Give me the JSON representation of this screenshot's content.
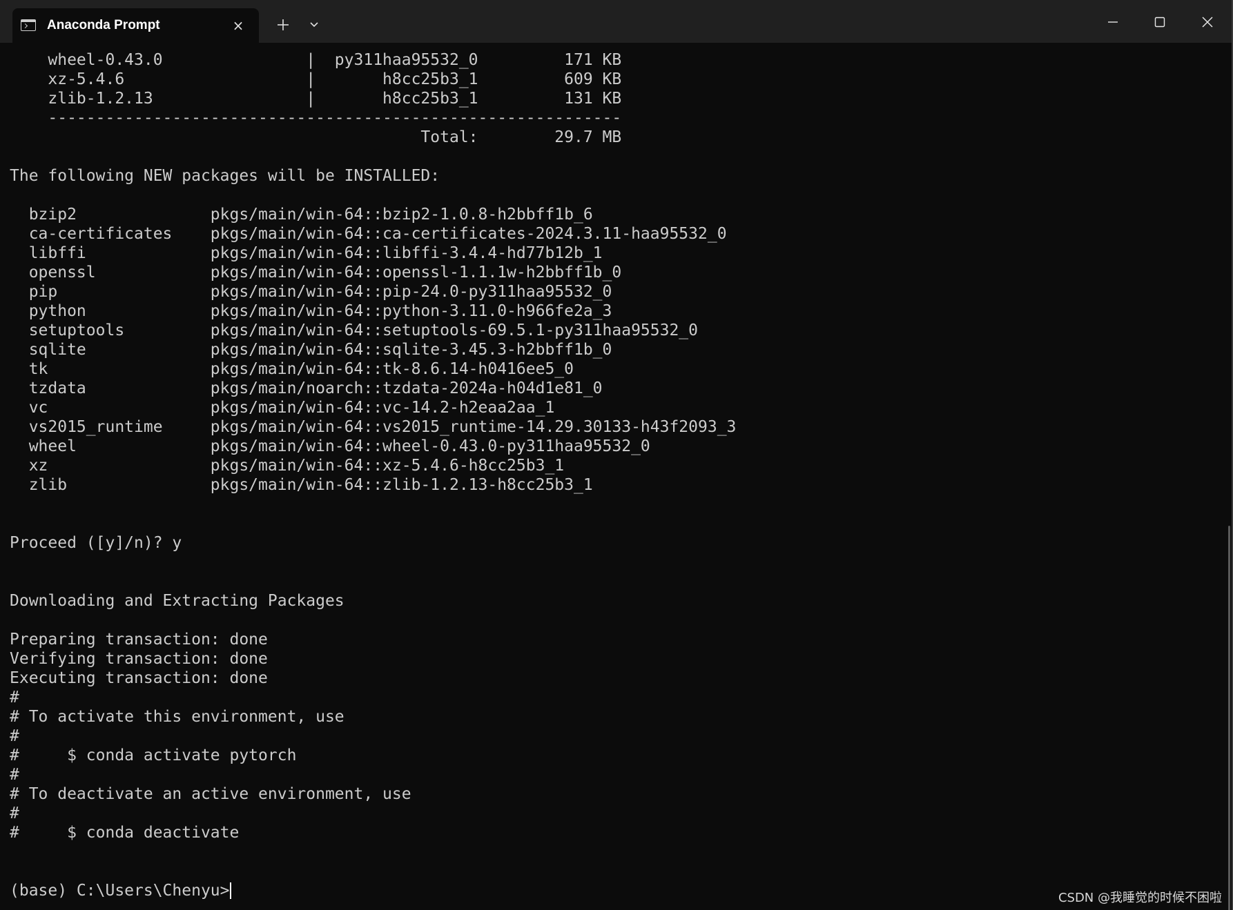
{
  "window": {
    "tab_title": "Anaconda Prompt",
    "close_tab_glyph": "×",
    "new_tab_glyph": "+"
  },
  "icons": {
    "tab_icon": "terminal-icon",
    "tab_close": "close-icon",
    "new_tab": "plus-icon",
    "dropdown": "chevron-down-icon",
    "minimize": "minimize-icon",
    "maximize": "maximize-icon",
    "close": "close-icon"
  },
  "colors": {
    "background": "#0c0c0c",
    "text": "#cccccc",
    "titlebar": "#202020"
  },
  "terminal": {
    "lines": [
      "    wheel-0.43.0               |  py311haa95532_0         171 KB",
      "    xz-5.4.6                   |       h8cc25b3_1         609 KB",
      "    zlib-1.2.13                |       h8cc25b3_1         131 KB",
      "    ------------------------------------------------------------",
      "                                           Total:        29.7 MB",
      "",
      "The following NEW packages will be INSTALLED:",
      "",
      "  bzip2              pkgs/main/win-64::bzip2-1.0.8-h2bbff1b_6",
      "  ca-certificates    pkgs/main/win-64::ca-certificates-2024.3.11-haa95532_0",
      "  libffi             pkgs/main/win-64::libffi-3.4.4-hd77b12b_1",
      "  openssl            pkgs/main/win-64::openssl-1.1.1w-h2bbff1b_0",
      "  pip                pkgs/main/win-64::pip-24.0-py311haa95532_0",
      "  python             pkgs/main/win-64::python-3.11.0-h966fe2a_3",
      "  setuptools         pkgs/main/win-64::setuptools-69.5.1-py311haa95532_0",
      "  sqlite             pkgs/main/win-64::sqlite-3.45.3-h2bbff1b_0",
      "  tk                 pkgs/main/win-64::tk-8.6.14-h0416ee5_0",
      "  tzdata             pkgs/main/noarch::tzdata-2024a-h04d1e81_0",
      "  vc                 pkgs/main/win-64::vc-14.2-h2eaa2aa_1",
      "  vs2015_runtime     pkgs/main/win-64::vs2015_runtime-14.29.30133-h43f2093_3",
      "  wheel              pkgs/main/win-64::wheel-0.43.0-py311haa95532_0",
      "  xz                 pkgs/main/win-64::xz-5.4.6-h8cc25b3_1",
      "  zlib               pkgs/main/win-64::zlib-1.2.13-h8cc25b3_1",
      "",
      "",
      "Proceed ([y]/n)? y",
      "",
      "",
      "Downloading and Extracting Packages",
      "",
      "Preparing transaction: done",
      "Verifying transaction: done",
      "Executing transaction: done",
      "#",
      "# To activate this environment, use",
      "#",
      "#     $ conda activate pytorch",
      "#",
      "# To deactivate an active environment, use",
      "#",
      "#     $ conda deactivate",
      "",
      "",
      "(base) C:\\Users\\Chenyu>"
    ]
  },
  "watermark": "CSDN @我睡觉的时候不困啦"
}
